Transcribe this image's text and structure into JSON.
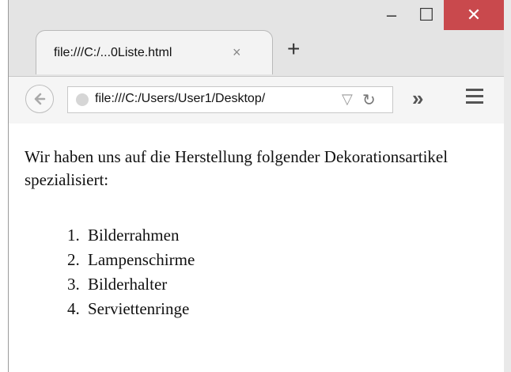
{
  "browser": {
    "tab": {
      "title": "file:///C:/...0Liste.html",
      "close_glyph": "×"
    },
    "new_tab_glyph": "+",
    "window_controls": {
      "minimize": "–",
      "maximize": "☐",
      "close": "✕"
    },
    "address": {
      "url": "file:///C:/Users/User1/Desktop/"
    },
    "toolbar": {
      "overflow": "»"
    }
  },
  "page": {
    "paragraph": "Wir haben uns auf die Herstellung folgender Dekorationsartikel spezialisiert:",
    "list": [
      {
        "number": "1.",
        "text": "Bilderrahmen"
      },
      {
        "number": "2.",
        "text": "Lampenschirme"
      },
      {
        "number": "3.",
        "text": "Bilderhalter"
      },
      {
        "number": "4.",
        "text": "Serviettenringe"
      }
    ]
  },
  "colors": {
    "close_button": "#c9494d",
    "content_bg": "#ffffff",
    "chrome_bg": "#e4e4e4"
  }
}
